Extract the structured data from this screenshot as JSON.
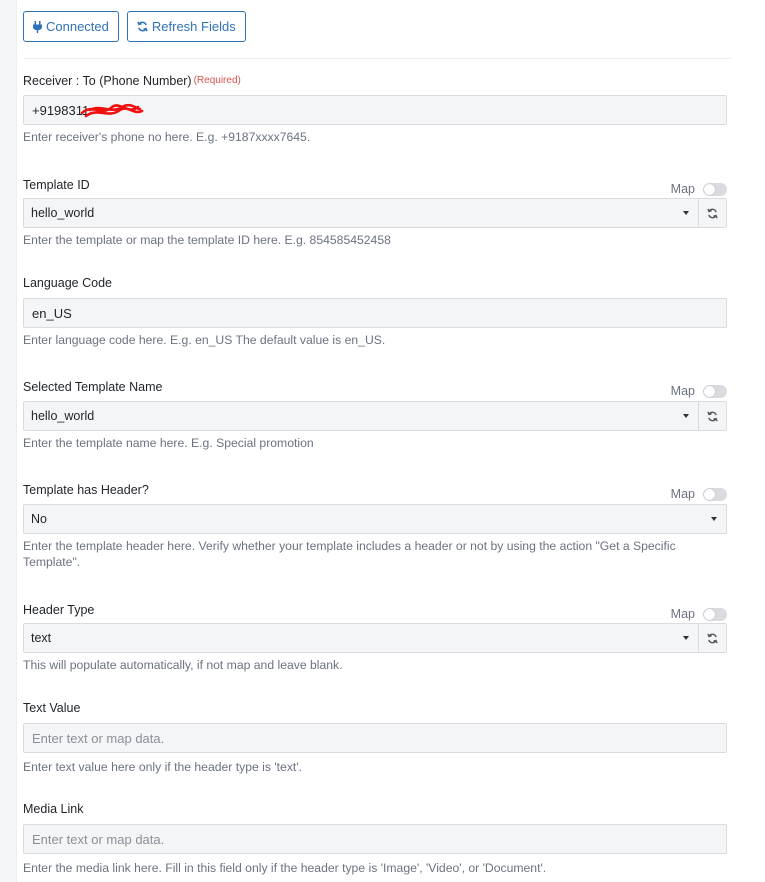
{
  "toolbar": {
    "connected_label": "Connected",
    "refresh_label": "Refresh Fields"
  },
  "colors": {
    "accent": "#2f72b8",
    "required": "#d9534f",
    "input_bg": "#f4f5f7",
    "border": "#d9dbdf",
    "help_text": "#6b7280"
  },
  "receiver": {
    "label": "Receiver : To (Phone Number)",
    "required": "(Required)",
    "value": "+9198311",
    "help": "Enter receiver's phone no here. E.g. +9187xxxx7645."
  },
  "template_id": {
    "label": "Template ID",
    "map_label": "Map",
    "value": "hello_world",
    "help": "Enter the template or map the template ID here. E.g. 854585452458"
  },
  "language_code": {
    "label": "Language Code",
    "value": "en_US",
    "help": "Enter language code here. E.g. en_US The default value is en_US."
  },
  "template_name": {
    "label": "Selected Template Name",
    "map_label": "Map",
    "value": "hello_world",
    "help": "Enter the template name here. E.g. Special promotion"
  },
  "has_header": {
    "label": "Template has Header?",
    "map_label": "Map",
    "value": "No",
    "help": "Enter the template header here. Verify whether your template includes a header or not by using the action \"Get a Specific Template\"."
  },
  "header_type": {
    "label": "Header Type",
    "map_label": "Map",
    "value": "text",
    "help": "This will populate automatically, if not map and leave blank."
  },
  "text_value": {
    "label": "Text Value",
    "placeholder": "Enter text or map data.",
    "help": "Enter text value here only if the header type is 'text'."
  },
  "media_link": {
    "label": "Media Link",
    "placeholder": "Enter text or map data.",
    "help": "Enter the media link here. Fill in this field only if the header type is 'Image', 'Video', or 'Document'."
  }
}
